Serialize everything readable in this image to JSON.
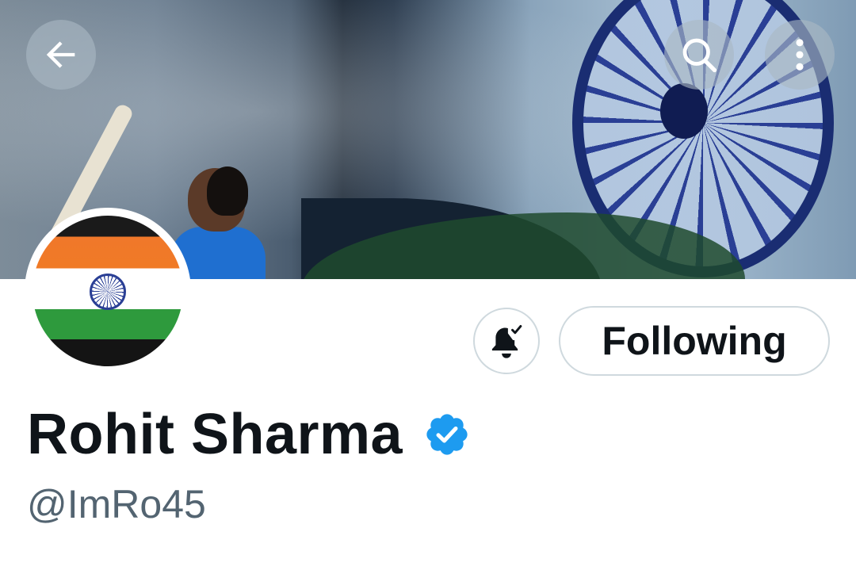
{
  "header": {
    "back_icon": "arrow-left-icon",
    "search_icon": "search-icon",
    "more_icon": "more-vertical-icon"
  },
  "profile": {
    "display_name": "Rohit Sharma",
    "handle": "@ImRo45",
    "verified": true,
    "verified_color": "#1d9bf0"
  },
  "actions": {
    "notify_icon": "bell-check-icon",
    "follow_label": "Following"
  },
  "colors": {
    "text_primary": "#0f1419",
    "text_secondary": "#536471",
    "button_border": "#cfd9de"
  }
}
